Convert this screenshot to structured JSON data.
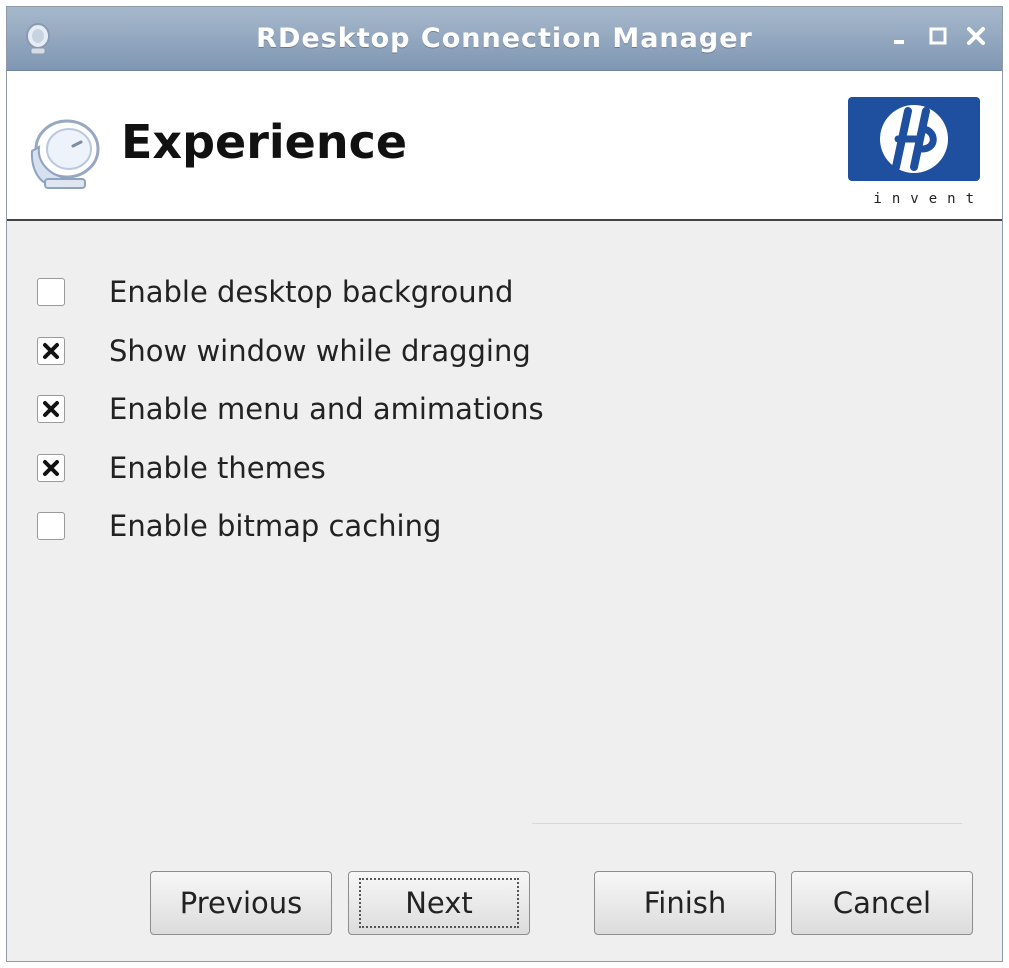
{
  "window": {
    "title": "RDesktop Connection Manager"
  },
  "header": {
    "title": "Experience",
    "logo_text": "hp",
    "logo_tagline": "invent"
  },
  "options": [
    {
      "label": "Enable desktop background",
      "checked": false
    },
    {
      "label": "Show window while dragging",
      "checked": true
    },
    {
      "label": "Enable menu and amimations",
      "checked": true
    },
    {
      "label": "Enable themes",
      "checked": true
    },
    {
      "label": "Enable bitmap caching",
      "checked": false
    }
  ],
  "buttons": {
    "previous": "Previous",
    "next": "Next",
    "finish": "Finish",
    "cancel": "Cancel"
  },
  "icons": {
    "title": "satellite-dish-icon",
    "header": "satellite-dish-icon",
    "minimize": "minimize-icon",
    "maximize": "maximize-icon",
    "close": "close-icon"
  },
  "colors": {
    "titlebar": "#8fa4bf",
    "hp_blue": "#1f4f9f",
    "window_bg": "#efefef"
  }
}
